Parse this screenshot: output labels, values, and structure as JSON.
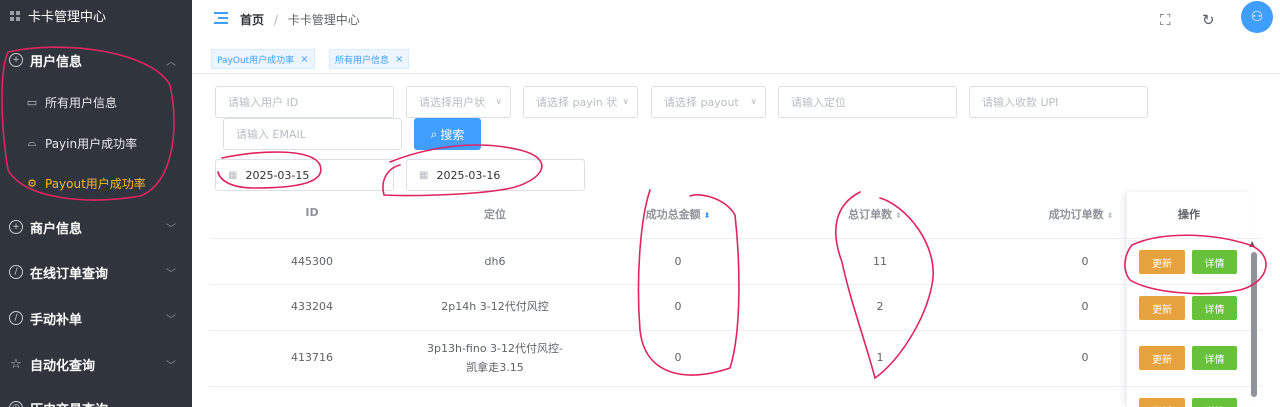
{
  "sidebar": {
    "brand": "卡卡管理中心",
    "menus": [
      {
        "label": "用户信息",
        "icon": "plus-circle-icon"
      },
      {
        "label": "商户信息",
        "icon": "plus-circle-icon"
      },
      {
        "label": "在线订单查询",
        "icon": "compass-icon"
      },
      {
        "label": "手动补单",
        "icon": "compass-icon"
      },
      {
        "label": "自动化查询",
        "icon": "star-icon"
      },
      {
        "label": "历史交易查询",
        "icon": "clock-icon"
      }
    ],
    "sub_items": [
      {
        "label": "所有用户信息",
        "icon": "document-icon"
      },
      {
        "label": "Payin用户成功率",
        "icon": "chart-icon"
      },
      {
        "label": "Payout用户成功率",
        "icon": "gear-icon",
        "active": true
      }
    ]
  },
  "header": {
    "crumb_home": "首页",
    "crumb_sep": "/",
    "crumb_current": "卡卡管理中心"
  },
  "tabs": [
    {
      "label": "PayOut用户成功率",
      "close": "×"
    },
    {
      "label": "所有用户信息",
      "close": "×"
    }
  ],
  "filters": {
    "user_id": "请输入用户 ID",
    "user_status": "请选择用户状",
    "payin_status": "请选择 payin 状",
    "payout_status": "请选择 payout 状",
    "location": "请输入定位",
    "upi": "请输入收款 UPI",
    "email": "请输入 EMAIL",
    "search_label": "搜索",
    "date_start": "2025-03-15",
    "date_end": "2025-03-16"
  },
  "table": {
    "columns": [
      "ID",
      "定位",
      "成功总金额",
      "总订单数",
      "成功订单数",
      "操作"
    ],
    "rows": [
      {
        "id": "445300",
        "loc1": "dh6",
        "loc2": "",
        "amount": "0",
        "orders": "11",
        "success": "0"
      },
      {
        "id": "433204",
        "loc1": "2p14h 3-12代付风控",
        "loc2": "",
        "amount": "0",
        "orders": "2",
        "success": "0"
      },
      {
        "id": "413716",
        "loc1": "3p13h-fino 3-12代付风控-",
        "loc2": "凯拿走3.15",
        "amount": "0",
        "orders": "1",
        "success": "0"
      }
    ],
    "update_label": "更新",
    "detail_label": "详情"
  },
  "colors": {
    "sidebar_bg": "#30353d",
    "accent": "#409eff",
    "active_menu": "#f5b829",
    "update_btn": "#e6a23c",
    "detail_btn": "#67c23a",
    "annotation_ink": "#e0245e"
  }
}
